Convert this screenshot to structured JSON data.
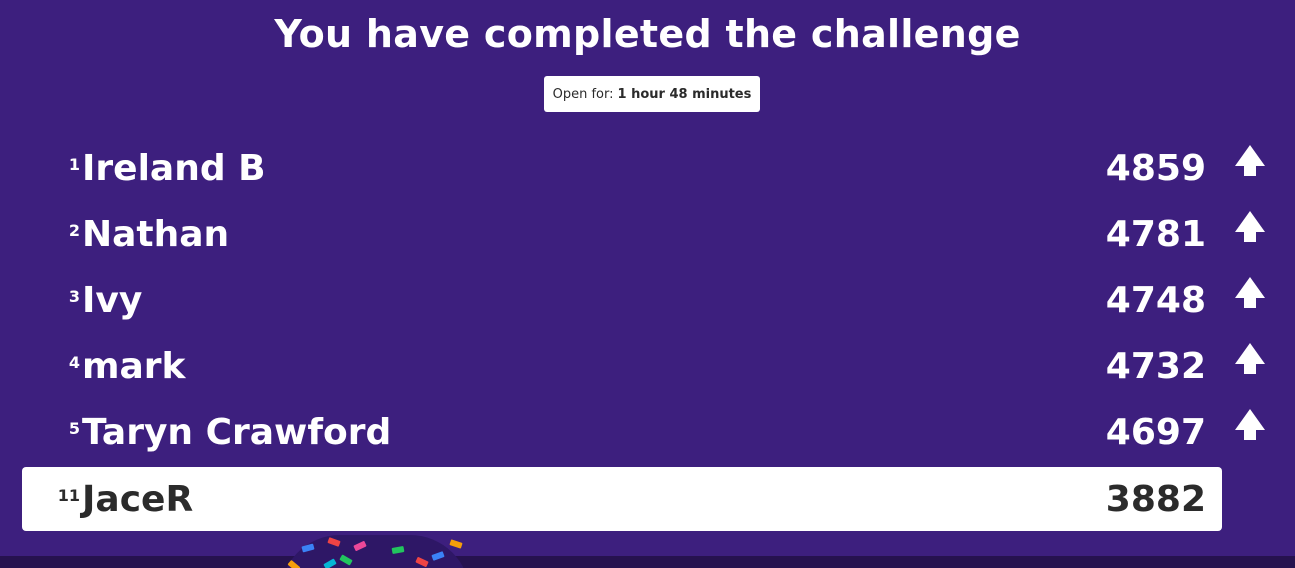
{
  "header": {
    "title": "You have completed the challenge",
    "open_for_label": "Open for:",
    "open_for_value": "1 hour 48 minutes"
  },
  "leaderboard": [
    {
      "rank": "1",
      "name": "Ireland B",
      "score": "4859",
      "icon": "arrow-up-icon"
    },
    {
      "rank": "2",
      "name": "Nathan",
      "score": "4781",
      "icon": "arrow-up-icon"
    },
    {
      "rank": "3",
      "name": "Ivy",
      "score": "4748",
      "icon": "arrow-up-icon"
    },
    {
      "rank": "4",
      "name": "mark",
      "score": "4732",
      "icon": "arrow-up-icon"
    },
    {
      "rank": "5",
      "name": "Taryn Crawford",
      "score": "4697",
      "icon": "arrow-up-icon"
    }
  ],
  "current_player": {
    "rank": "11",
    "name": "JaceR",
    "score": "3882"
  },
  "colors": {
    "background": "#3d1f7e",
    "highlight_row": "#ffffff",
    "text_light": "#ffffff",
    "text_dark": "#2b2b2b"
  }
}
